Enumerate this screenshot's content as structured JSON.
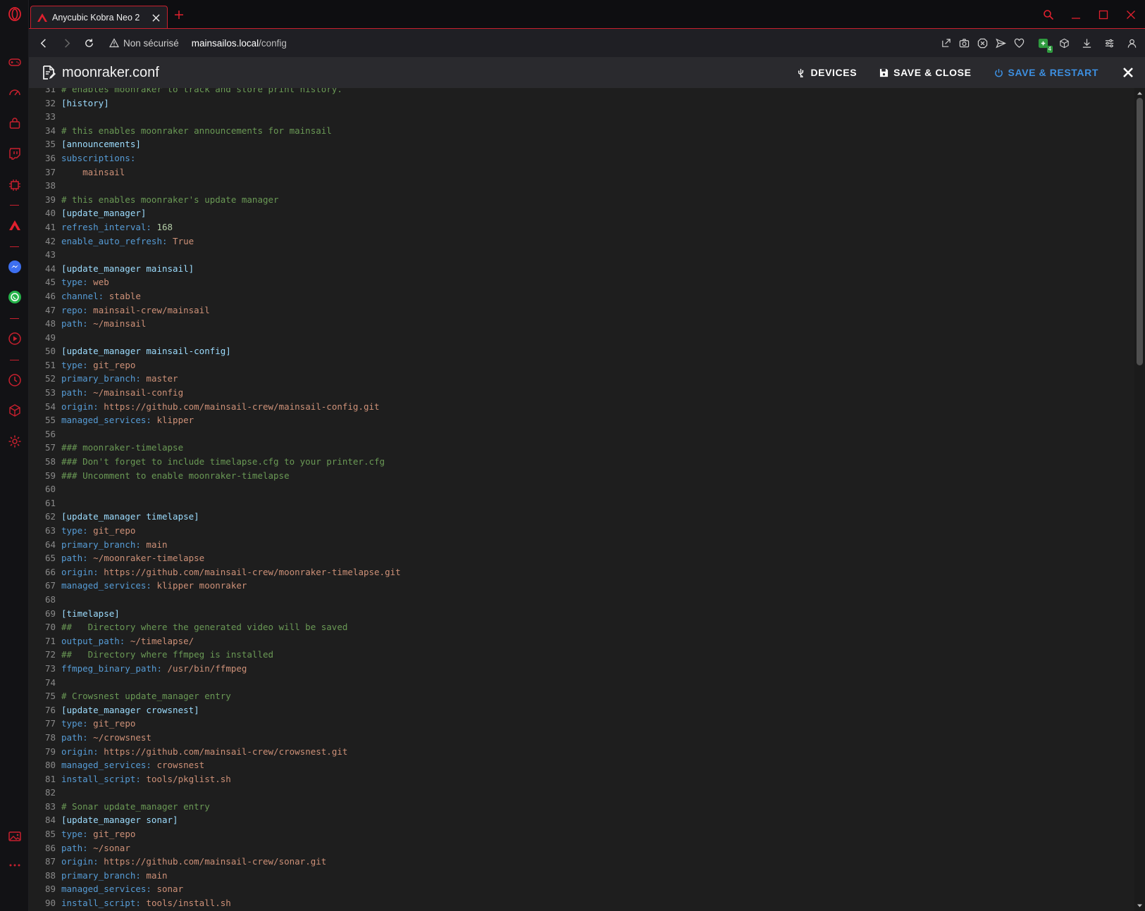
{
  "browser": {
    "tab_title": "Anycubic Kobra Neo 2",
    "security_label": "Non sécurisé",
    "url_host": "mainsailos.local",
    "url_path": "/config",
    "extension_badge": "4",
    "accent_color": "#c8202e"
  },
  "editor": {
    "filename": "moonraker.conf",
    "actions": {
      "devices": "DEVICES",
      "save_close": "SAVE & CLOSE",
      "save_restart": "SAVE & RESTART"
    }
  },
  "code_lines": [
    {
      "n": "31",
      "t": "comment",
      "text": "# enables moonraker to track and store print history."
    },
    {
      "n": "32",
      "t": "section",
      "text": "[history]"
    },
    {
      "n": "33",
      "t": "blank",
      "text": ""
    },
    {
      "n": "34",
      "t": "comment",
      "text": "# this enables moonraker announcements for mainsail"
    },
    {
      "n": "35",
      "t": "section",
      "text": "[announcements]"
    },
    {
      "n": "36",
      "t": "kv",
      "key": "subscriptions:",
      "val": ""
    },
    {
      "n": "37",
      "t": "indent",
      "text": "    mainsail"
    },
    {
      "n": "38",
      "t": "blank",
      "text": ""
    },
    {
      "n": "39",
      "t": "comment",
      "text": "# this enables moonraker's update manager"
    },
    {
      "n": "40",
      "t": "section",
      "text": "[update_manager]"
    },
    {
      "n": "41",
      "t": "kvnum",
      "key": "refresh_interval:",
      "val": "168"
    },
    {
      "n": "42",
      "t": "kv",
      "key": "enable_auto_refresh:",
      "val": "True"
    },
    {
      "n": "43",
      "t": "blank",
      "text": ""
    },
    {
      "n": "44",
      "t": "section",
      "text": "[update_manager mainsail]"
    },
    {
      "n": "45",
      "t": "kv",
      "key": "type:",
      "val": "web"
    },
    {
      "n": "46",
      "t": "kv",
      "key": "channel:",
      "val": "stable"
    },
    {
      "n": "47",
      "t": "kv",
      "key": "repo:",
      "val": "mainsail-crew/mainsail"
    },
    {
      "n": "48",
      "t": "kv",
      "key": "path:",
      "val": "~/mainsail"
    },
    {
      "n": "49",
      "t": "blank",
      "text": ""
    },
    {
      "n": "50",
      "t": "section",
      "text": "[update_manager mainsail-config]"
    },
    {
      "n": "51",
      "t": "kv",
      "key": "type:",
      "val": "git_repo"
    },
    {
      "n": "52",
      "t": "kv",
      "key": "primary_branch:",
      "val": "master"
    },
    {
      "n": "53",
      "t": "kv",
      "key": "path:",
      "val": "~/mainsail-config"
    },
    {
      "n": "54",
      "t": "kv",
      "key": "origin:",
      "val": "https://github.com/mainsail-crew/mainsail-config.git"
    },
    {
      "n": "55",
      "t": "kv",
      "key": "managed_services:",
      "val": "klipper"
    },
    {
      "n": "56",
      "t": "blank",
      "text": ""
    },
    {
      "n": "57",
      "t": "comment",
      "text": "### moonraker-timelapse"
    },
    {
      "n": "58",
      "t": "comment",
      "text": "### Don't forget to include timelapse.cfg to your printer.cfg"
    },
    {
      "n": "59",
      "t": "comment",
      "text": "### Uncomment to enable moonraker-timelapse"
    },
    {
      "n": "60",
      "t": "blank",
      "text": ""
    },
    {
      "n": "61",
      "t": "blank",
      "text": ""
    },
    {
      "n": "62",
      "t": "section",
      "text": "[update_manager timelapse]"
    },
    {
      "n": "63",
      "t": "kv",
      "key": "type:",
      "val": "git_repo"
    },
    {
      "n": "64",
      "t": "kv",
      "key": "primary_branch:",
      "val": "main"
    },
    {
      "n": "65",
      "t": "kv",
      "key": "path:",
      "val": "~/moonraker-timelapse"
    },
    {
      "n": "66",
      "t": "kv",
      "key": "origin:",
      "val": "https://github.com/mainsail-crew/moonraker-timelapse.git"
    },
    {
      "n": "67",
      "t": "kv",
      "key": "managed_services:",
      "val": "klipper moonraker"
    },
    {
      "n": "68",
      "t": "blank",
      "text": ""
    },
    {
      "n": "69",
      "t": "section",
      "text": "[timelapse]"
    },
    {
      "n": "70",
      "t": "comment",
      "text": "##   Directory where the generated video will be saved"
    },
    {
      "n": "71",
      "t": "kv",
      "key": "output_path:",
      "val": "~/timelapse/"
    },
    {
      "n": "72",
      "t": "comment",
      "text": "##   Directory where ffmpeg is installed"
    },
    {
      "n": "73",
      "t": "kv",
      "key": "ffmpeg_binary_path:",
      "val": "/usr/bin/ffmpeg"
    },
    {
      "n": "74",
      "t": "blank",
      "text": ""
    },
    {
      "n": "75",
      "t": "comment",
      "text": "# Crowsnest update_manager entry"
    },
    {
      "n": "76",
      "t": "section",
      "text": "[update_manager crowsnest]"
    },
    {
      "n": "77",
      "t": "kv",
      "key": "type:",
      "val": "git_repo"
    },
    {
      "n": "78",
      "t": "kv",
      "key": "path:",
      "val": "~/crowsnest"
    },
    {
      "n": "79",
      "t": "kv",
      "key": "origin:",
      "val": "https://github.com/mainsail-crew/crowsnest.git"
    },
    {
      "n": "80",
      "t": "kv",
      "key": "managed_services:",
      "val": "crowsnest"
    },
    {
      "n": "81",
      "t": "kv",
      "key": "install_script:",
      "val": "tools/pkglist.sh"
    },
    {
      "n": "82",
      "t": "blank",
      "text": ""
    },
    {
      "n": "83",
      "t": "comment",
      "text": "# Sonar update_manager entry"
    },
    {
      "n": "84",
      "t": "section",
      "text": "[update_manager sonar]"
    },
    {
      "n": "85",
      "t": "kv",
      "key": "type:",
      "val": "git_repo"
    },
    {
      "n": "86",
      "t": "kv",
      "key": "path:",
      "val": "~/sonar"
    },
    {
      "n": "87",
      "t": "kv",
      "key": "origin:",
      "val": "https://github.com/mainsail-crew/sonar.git"
    },
    {
      "n": "88",
      "t": "kv",
      "key": "primary_branch:",
      "val": "main"
    },
    {
      "n": "89",
      "t": "kv",
      "key": "managed_services:",
      "val": "sonar"
    },
    {
      "n": "90",
      "t": "kv",
      "key": "install_script:",
      "val": "tools/install.sh"
    }
  ]
}
